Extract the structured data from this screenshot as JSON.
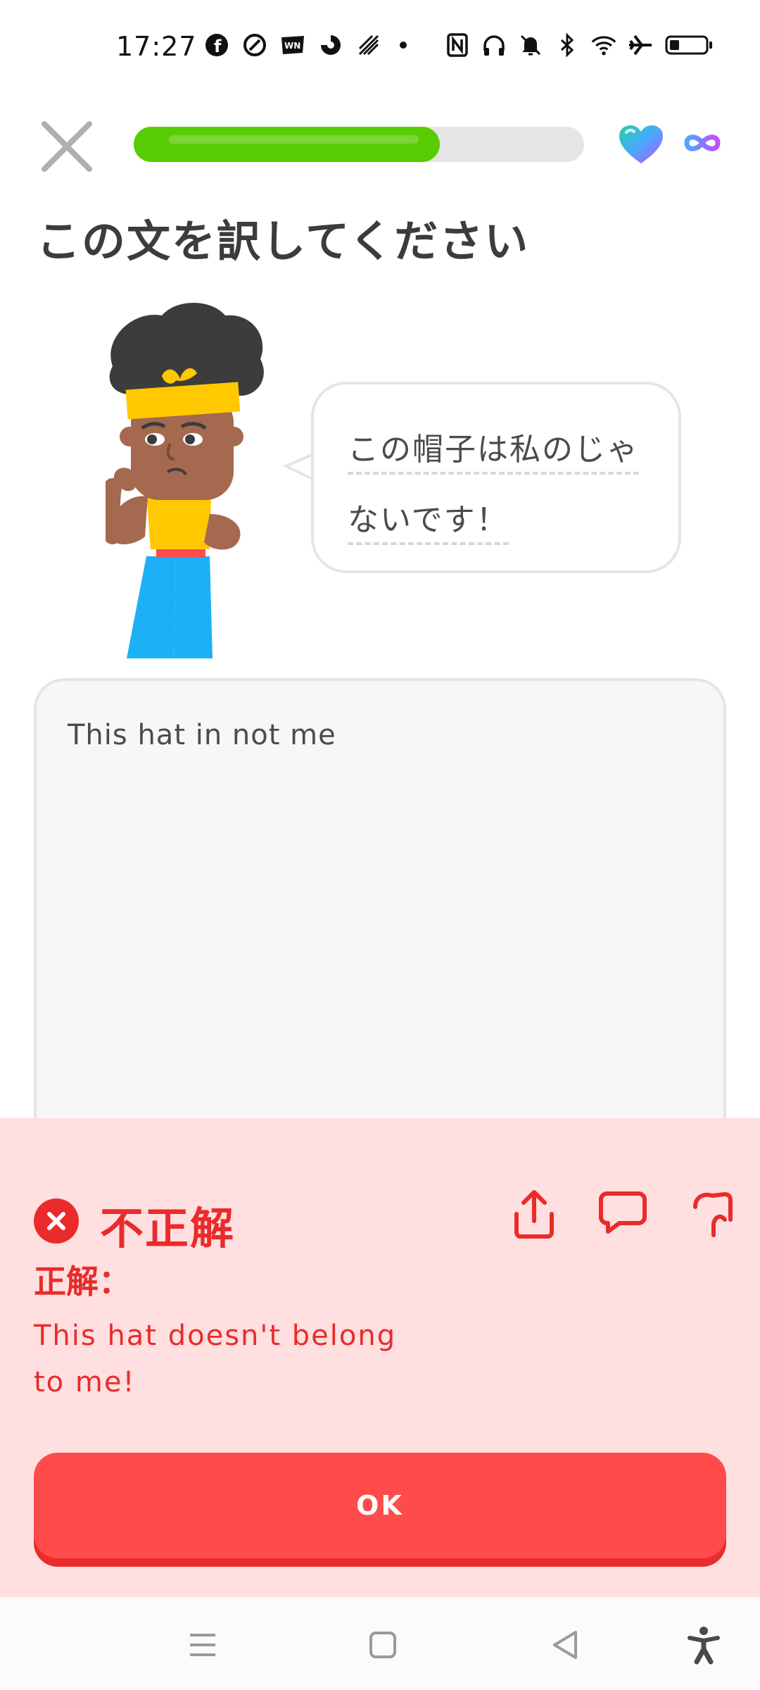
{
  "status_bar": {
    "time": "17:27",
    "left_icons": [
      "facebook-icon",
      "app-icon",
      "news-icon",
      "app-swirl-icon",
      "app-signal-icon"
    ],
    "right_icons": [
      "nfc-icon",
      "headphones-icon",
      "mute-icon",
      "bluetooth-icon",
      "wifi-icon",
      "airplane-icon",
      "battery-icon"
    ]
  },
  "lesson": {
    "progress": 0.68,
    "hearts": "infinite",
    "instruction": "この文を訳してください",
    "prompt_line1": "この帽子は私のじゃ",
    "prompt_line2": "ないです！",
    "user_answer": "This hat in not me"
  },
  "feedback": {
    "title": "不正解",
    "correct_label": "正解：",
    "correct_answer": "This hat doesn't belong to me!",
    "ok_label": "OK",
    "actions": [
      "share-icon",
      "comment-icon",
      "flag-icon"
    ]
  },
  "colors": {
    "green": "#58cc02",
    "error_red": "#ea2b2b",
    "error_bg": "#ffdfe0",
    "button_red": "#ff4b4b"
  }
}
